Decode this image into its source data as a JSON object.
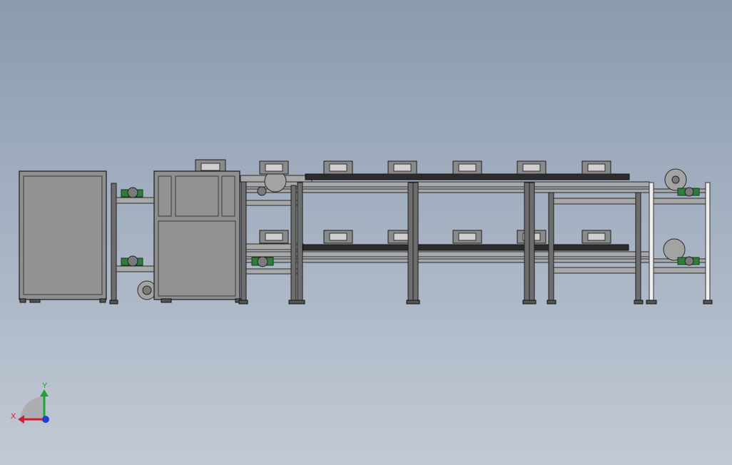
{
  "view": {
    "background_top": "#8a9bb0",
    "background_bottom": "#c2c9d4"
  },
  "triad": {
    "x_label": "X",
    "y_label": "Y",
    "x_color": "#d0202a",
    "y_color": "#1fa23a",
    "z_color": "#2040d0",
    "icons": [
      "x-axis-arrow-icon",
      "y-axis-arrow-icon",
      "z-axis-dot-icon"
    ]
  },
  "model": {
    "description_icons": [
      "cabinet",
      "conveyor-frame",
      "belt",
      "roller",
      "sprocket",
      "bearing-block",
      "mounting-plate"
    ],
    "colors": {
      "frame": "#6d6d6d",
      "belt": "#2c2c2c",
      "bearing": "#2f7d3a",
      "panel": "#8f8f8f"
    }
  }
}
